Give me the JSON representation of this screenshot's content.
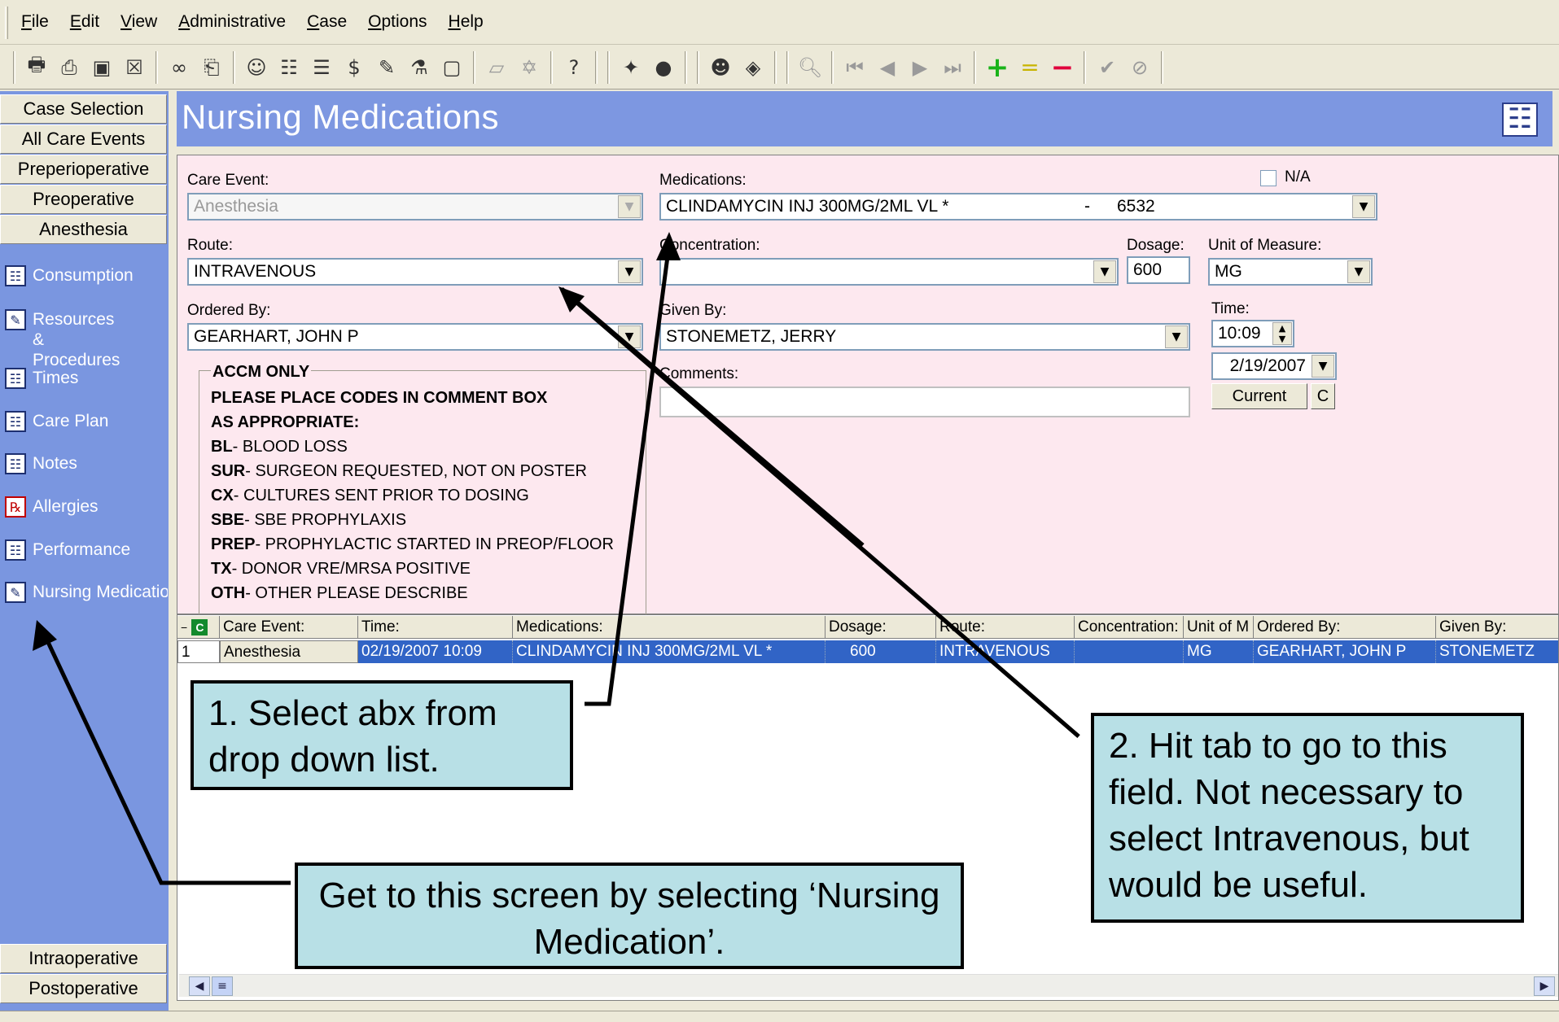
{
  "menu": [
    "File",
    "Edit",
    "View",
    "Administrative",
    "Case",
    "Options",
    "Help"
  ],
  "sidebar": {
    "top_buttons": [
      "Case Selection",
      "All Care Events",
      "Preperioperative",
      "Preoperative",
      "Anesthesia"
    ],
    "items": [
      {
        "label": "Consumption"
      },
      {
        "label": "Resources & Procedures"
      },
      {
        "label": "Times"
      },
      {
        "label": "Care Plan"
      },
      {
        "label": "Notes"
      },
      {
        "label": "Allergies"
      },
      {
        "label": "Performance"
      },
      {
        "label": "Nursing Medication"
      }
    ],
    "bottom_buttons": [
      "Intraoperative",
      "Postoperative"
    ]
  },
  "page_title": "Nursing Medications",
  "form": {
    "care_event_label": "Care Event:",
    "care_event_value": "Anesthesia",
    "medications_label": "Medications:",
    "medications_value": "CLINDAMYCIN INJ 300MG/2ML VL *",
    "medications_dash": "-",
    "medications_code": "6532",
    "na_label": "N/A",
    "route_label": "Route:",
    "route_value": "INTRAVENOUS",
    "concentration_label": "Concentration:",
    "concentration_value": "",
    "dosage_label": "Dosage:",
    "dosage_value": "600",
    "uom_label": "Unit of Measure:",
    "uom_value": "MG",
    "ordered_by_label": "Ordered By:",
    "ordered_by_value": "GEARHART, JOHN P",
    "given_by_label": "Given By:",
    "given_by_value": "STONEMETZ, JERRY",
    "time_label": "Time:",
    "time_value": "10:09",
    "date_value": "2/19/2007",
    "current_button": "Current",
    "c_button": "C",
    "comments_label": "Comments:",
    "comments_value": ""
  },
  "accm": {
    "title": "ACCM ONLY",
    "lines": [
      {
        "code": "PLEASE PLACE CODES IN COMMENT BOX",
        "text": ""
      },
      {
        "code": "AS APPROPRIATE:",
        "text": ""
      },
      {
        "code": "BL",
        "text": "- BLOOD LOSS"
      },
      {
        "code": "SUR",
        "text": "-  SURGEON REQUESTED, NOT ON POSTER"
      },
      {
        "code": "CX",
        "text": "- CULTURES SENT PRIOR TO DOSING"
      },
      {
        "code": "SBE",
        "text": "- SBE PROPHYLAXIS"
      },
      {
        "code": "PREP",
        "text": "- PROPHYLACTIC STARTED IN PREOP/FLOOR"
      },
      {
        "code": "TX",
        "text": "- DONOR VRE/MRSA POSITIVE"
      },
      {
        "code": "OTH",
        "text": "-  OTHER PLEASE DESCRIBE"
      }
    ]
  },
  "table": {
    "headers": [
      "Care Event:",
      "Time:",
      "Medications:",
      "Dosage:",
      "Route:",
      "Concentration:",
      "Unit of M",
      "Ordered By:",
      "Given By:"
    ],
    "rows": [
      {
        "num": "1",
        "care_event": "Anesthesia",
        "time": "02/19/2007 10:09",
        "medication": "CLINDAMYCIN INJ 300MG/2ML VL *",
        "dosage": "600",
        "route": "INTRAVENOUS",
        "concentration": "",
        "uom": "MG",
        "ordered_by": "GEARHART, JOHN P",
        "given_by": "STONEMETZ"
      }
    ]
  },
  "callouts": {
    "step1": "1. Select abx from drop down list.",
    "step2": "2. Hit tab to go to this field. Not necessary to select Intravenous, but would be useful.",
    "step0": "Get to this screen by selecting ‘Nursing Medication’."
  }
}
